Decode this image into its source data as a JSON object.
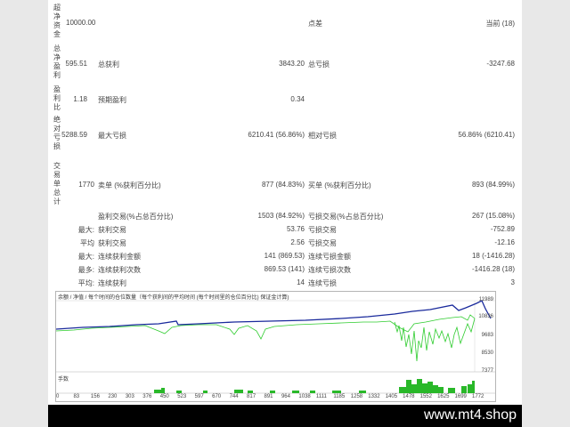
{
  "left_labels": [
    "超净资金",
    "总净盈利",
    "盈利比",
    "绝对亏损",
    "交易单总计"
  ],
  "rows": {
    "r1": {
      "c1": "10000.00",
      "c3": "点差",
      "c5": "当前 (18)"
    },
    "r2": {
      "c1": "595.51",
      "c2": "总获利",
      "c3": "3843.20",
      "c4": "总亏损",
      "c5": "-3247.68"
    },
    "r3": {
      "c1": "1.18",
      "c2": "预期盈利",
      "c3": "0.34"
    },
    "r4": {
      "c1": "5288.59",
      "c2": "最大亏损",
      "c3": "6210.41 (56.86%)",
      "c4": "相对亏损",
      "c5": "56.86% (6210.41)"
    },
    "r5": {
      "c1": "1770",
      "c2": "卖单 (%获利百分比)",
      "c3": "877 (84.83%)",
      "c4": "买单 (%获利百分比)",
      "c5": "893 (84.99%)"
    },
    "r6": {
      "c2": "盈利交易(%占总百分比)",
      "c3": "1503 (84.92%)",
      "c4": "亏损交易(%占总百分比)",
      "c5": "267 (15.08%)"
    },
    "r7": {
      "c1": "最大:",
      "c2": "获利交易",
      "c3": "53.76",
      "c4": "亏损交易",
      "c5": "-752.89"
    },
    "r8": {
      "c1": "平均",
      "c2": "获利交易",
      "c3": "2.56",
      "c4": "亏损交易",
      "c5": "-12.16"
    },
    "r9": {
      "c1": "最大:",
      "c2": "连续获利金额",
      "c3": "141 (869.53)",
      "c4": "连续亏损金额",
      "c5": "18 (-1416.28)"
    },
    "r10": {
      "c1": "最多:",
      "c2": "连续获利次数",
      "c3": "869.53 (141)",
      "c4": "连续亏损次数",
      "c5": "-1416.28 (18)"
    },
    "r11": {
      "c1": "平均:",
      "c2": "连续获利",
      "c3": "14",
      "c4": "连续亏损",
      "c5": "3"
    }
  },
  "chart": {
    "header": "余额 / 净值 / 每个时间的仓位数量（每个获利间的平均时间 (每个时间里的仓位百分比) 保证金计算)",
    "volume_label": "手数",
    "y_ticks": [
      "11989",
      "10836",
      "9683",
      "8530",
      "7377"
    ],
    "x_ticks": [
      "0",
      "83",
      "156",
      "230",
      "303",
      "376",
      "450",
      "523",
      "597",
      "670",
      "744",
      "817",
      "891",
      "964",
      "1038",
      "1111",
      "1185",
      "1258",
      "1332",
      "1405",
      "1478",
      "1552",
      "1625",
      "1699",
      "1772"
    ],
    "colors": {
      "balance": "#1a2a9c",
      "equity": "#2ecc2e",
      "volume": "#29b829"
    }
  },
  "footer": {
    "text": "www.mt4.shop"
  }
}
